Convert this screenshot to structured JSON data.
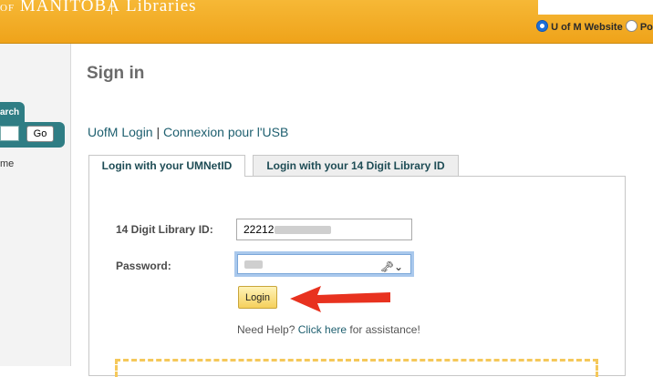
{
  "header": {
    "brand_of": "OF",
    "brand_name": "MANITOBA",
    "brand_libraries": "Libraries",
    "radio_selected": "U of M Website",
    "radio_other": "Po"
  },
  "sidebar": {
    "search_tab": "arch",
    "go_label": "Go",
    "link_fragment": "me"
  },
  "main": {
    "title": "Sign in",
    "link_uofm": "UofM Login",
    "link_sep": "|",
    "link_usb": "Connexion pour l'USB",
    "tabs": [
      {
        "label": "Login with your UMNetID",
        "active": true
      },
      {
        "label": "Login with your 14 Digit Library ID",
        "active": false
      }
    ],
    "form": {
      "library_id_label": "14 Digit Library ID:",
      "library_id_value": "22212",
      "password_label": "Password:",
      "login_label": "Login",
      "help_prefix": "Need Help?",
      "help_link": "Click here",
      "help_suffix": "for assistance!"
    }
  },
  "colors": {
    "header": "#f0a51c",
    "teal": "#2f7d84",
    "link": "#1e5f6f",
    "arrow": "#e8321f"
  }
}
